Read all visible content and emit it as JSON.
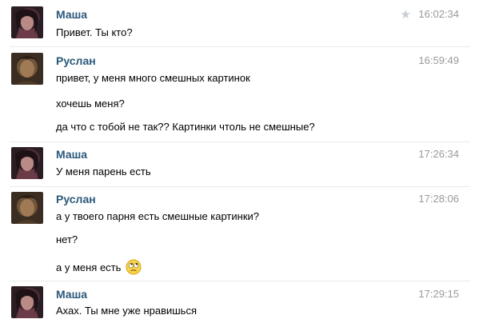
{
  "messages": [
    {
      "author": "Маша",
      "avatar": "avatar-masha",
      "time": "16:02:34",
      "starred": true,
      "lines": [
        "Привет. Ты кто?"
      ]
    },
    {
      "author": "Руслан",
      "avatar": "avatar-ruslan",
      "time": "16:59:49",
      "lines": [
        "привет, у меня много смешных картинок",
        "хочешь меня?",
        "да что с тобой не так?? Картинки чтоль не смешные?"
      ]
    },
    {
      "author": "Маша",
      "avatar": "avatar-masha",
      "time": "17:26:34",
      "lines": [
        "У меня парень есть"
      ]
    },
    {
      "author": "Руслан",
      "avatar": "avatar-ruslan",
      "time": "17:28:06",
      "lines": [
        "а у твоего парня есть смешные картинки?",
        "нет?",
        "а у меня есть"
      ],
      "last_line_emoji": "rolling-eyes-emoji"
    },
    {
      "author": "Маша",
      "avatar": "avatar-masha",
      "time": "17:29:15",
      "lines": [
        "Ахах. Ты мне уже нравишься"
      ]
    }
  ],
  "colors": {
    "author_link": "#2b587a",
    "timestamp": "#999999",
    "star": "#c6cdd5"
  }
}
